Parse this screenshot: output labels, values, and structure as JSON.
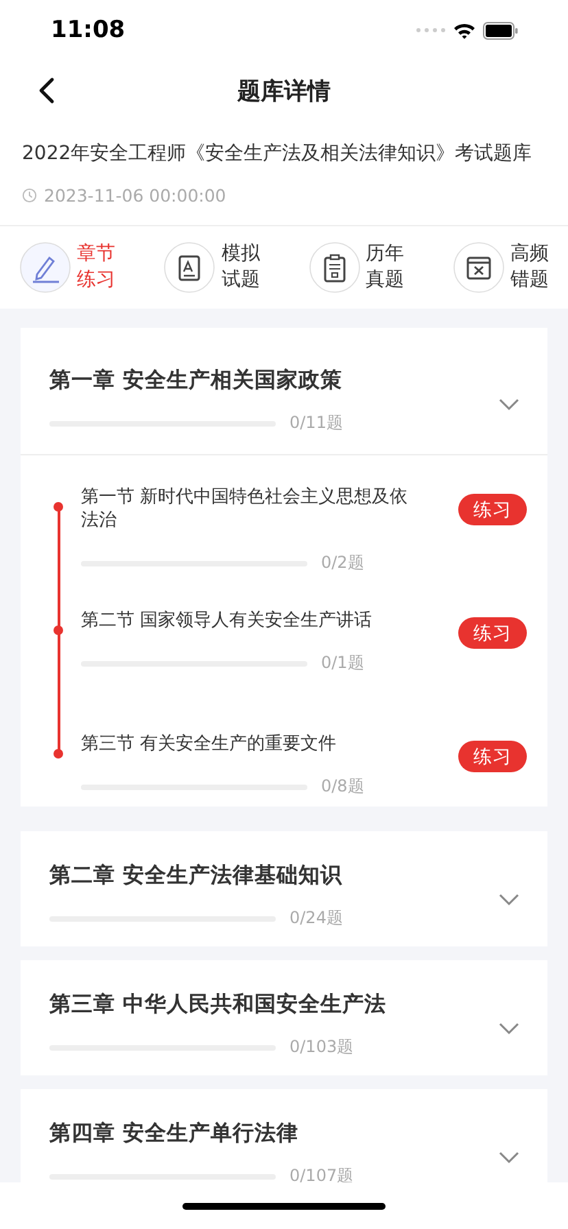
{
  "status_bar": {
    "time": "11:08"
  },
  "nav": {
    "title": "题库详情"
  },
  "bank": {
    "title": "2022年安全工程师《安全生产法及相关法律知识》考试题库",
    "date": "2023-11-06 00:00:00"
  },
  "tabs": [
    {
      "kind": "pencil",
      "label": "章节练习",
      "selected": true
    },
    {
      "kind": "paper",
      "label": "模拟试题",
      "selected": false
    },
    {
      "kind": "clipboard",
      "label": "历年真题",
      "selected": false
    },
    {
      "kind": "wrong",
      "label": "高频错题",
      "selected": false
    }
  ],
  "chapters": [
    {
      "title": "第一章 安全生产相关国家政策",
      "level": 0,
      "count": "0/11题",
      "sections": [
        {
          "title": "第一节 新时代中国特色社会主义思想及依法治",
          "level": 0,
          "count": "0/2题",
          "button": "练习"
        },
        {
          "title": "第二节 国家领导人有关安全生产讲话",
          "level": 0,
          "count": "0/1题",
          "button": "练习"
        },
        {
          "title": "第三节 有关安全生产的重要文件",
          "level": 0,
          "count": "0/8题",
          "button": "练习"
        }
      ]
    },
    {
      "title": "第二章 安全生产法律基础知识",
      "level": 0,
      "count": "0/24题"
    },
    {
      "title": "第三章 中华人民共和国安全生产法",
      "level": 0,
      "count": "0/103题"
    },
    {
      "title": "第四章 安全生产单行法律",
      "level": 0,
      "count": "0/107题"
    }
  ]
}
